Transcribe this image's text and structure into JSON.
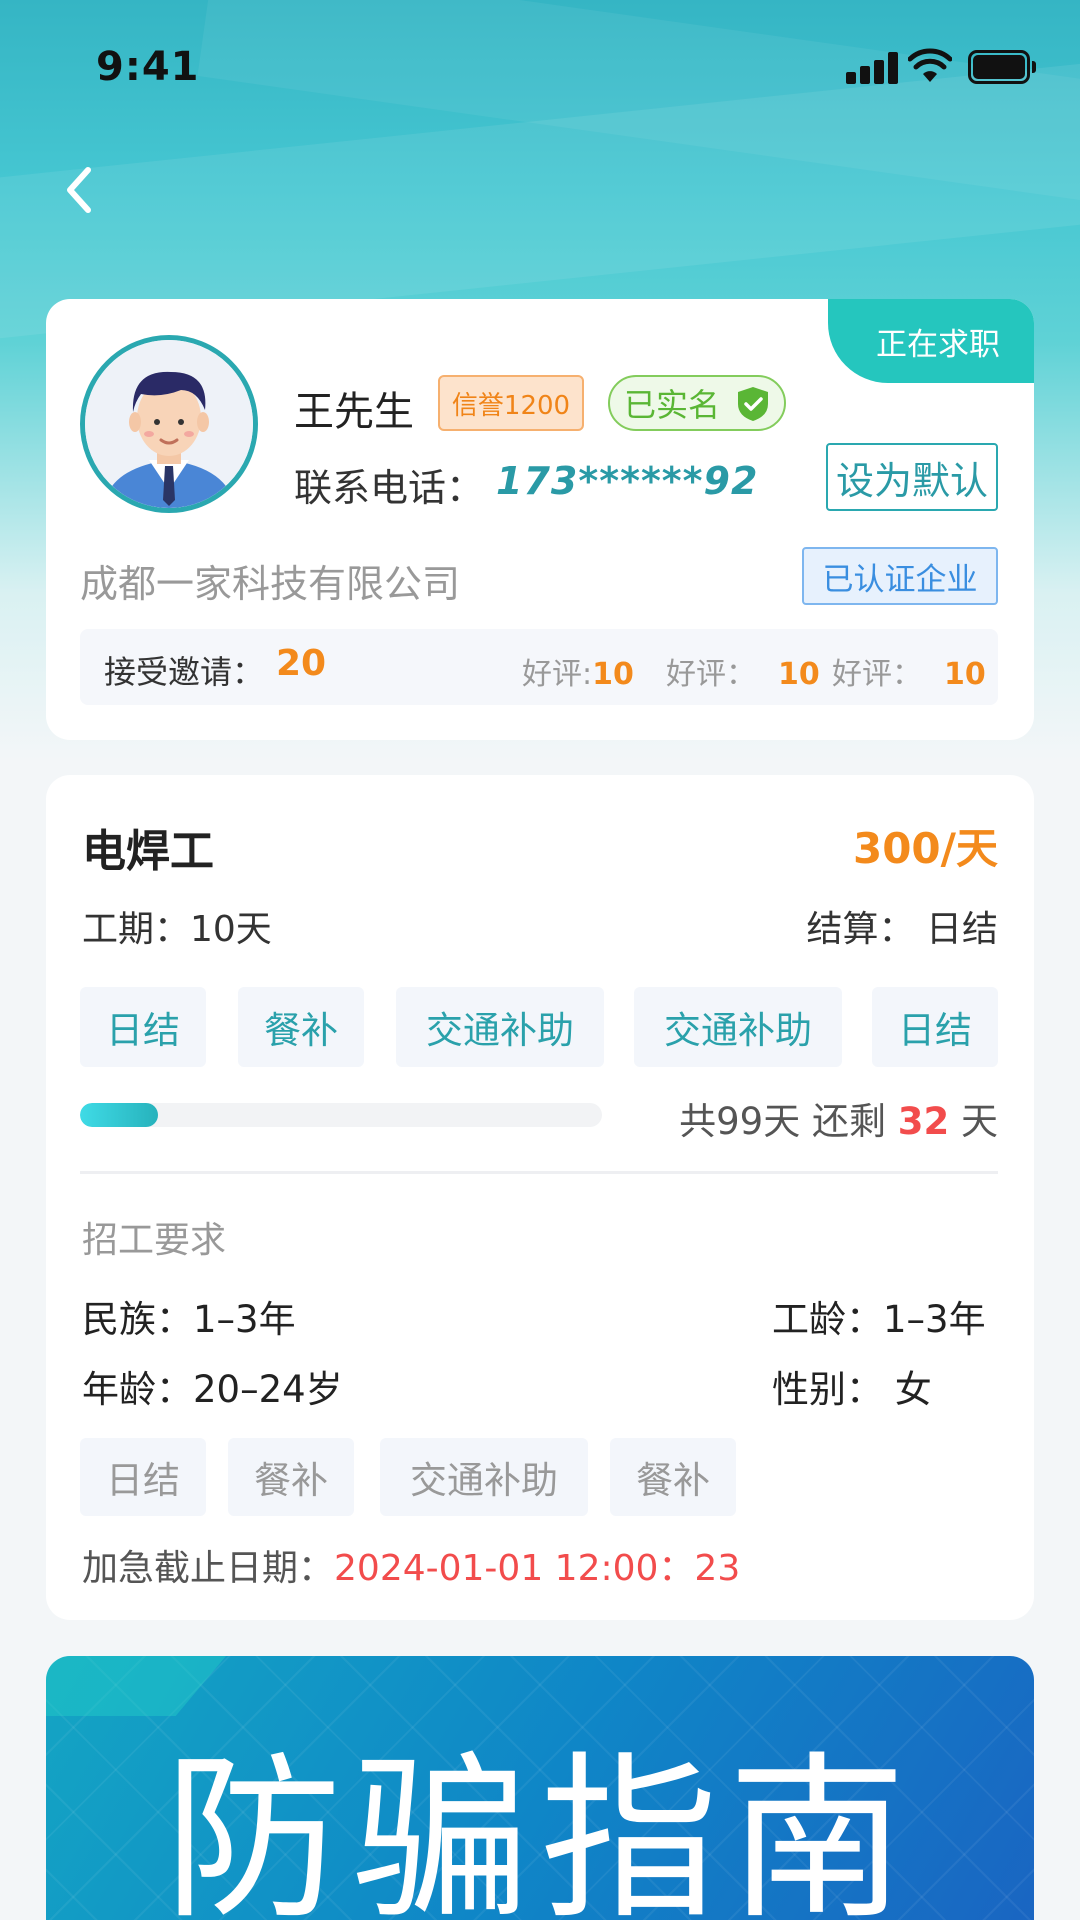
{
  "status_bar": {
    "time": "9:41"
  },
  "profile": {
    "job_status": "正在求职",
    "name": "王先生",
    "credit": "信誉1200",
    "verified": "已实名",
    "phone_label": "联系电话：",
    "phone": "173******92",
    "set_default": "设为默认",
    "company": "成都一家科技有限公司",
    "company_cert": "已认证企业",
    "stats": {
      "accept_label": "接受邀请：",
      "accept_value": "20",
      "reviews": [
        {
          "label": "好评:",
          "value": "10"
        },
        {
          "label": "好评：",
          "value": "10"
        },
        {
          "label": "好评：",
          "value": "10"
        }
      ]
    }
  },
  "job": {
    "title": "电焊工",
    "salary": "300/天",
    "period": "工期：10天",
    "settlement": "结算：  日结",
    "tags": [
      "日结",
      "餐补",
      "交通补助",
      "交通补助",
      "日结"
    ],
    "progress": {
      "fraction": 0.15,
      "total_text": "共99天 还剩 ",
      "remain": "32",
      "unit": " 天"
    },
    "requirements_title": "招工要求",
    "requirements": {
      "ethnicity": "民族：1–3年",
      "seniority": "工龄：1–3年",
      "age": "年龄：20–24岁",
      "gender": "性别：  女"
    },
    "req_tags": [
      "日结",
      "餐补",
      "交通补助",
      "餐补"
    ],
    "deadline_label": "加急截止日期：",
    "deadline_value": "2024-01-01 12:00：23"
  },
  "banner": {
    "title": "防骗指南"
  },
  "colors": {
    "accent_teal": "#2aa8b0",
    "salary_orange": "#f38a1c",
    "alert_red": "#f24c4c"
  }
}
